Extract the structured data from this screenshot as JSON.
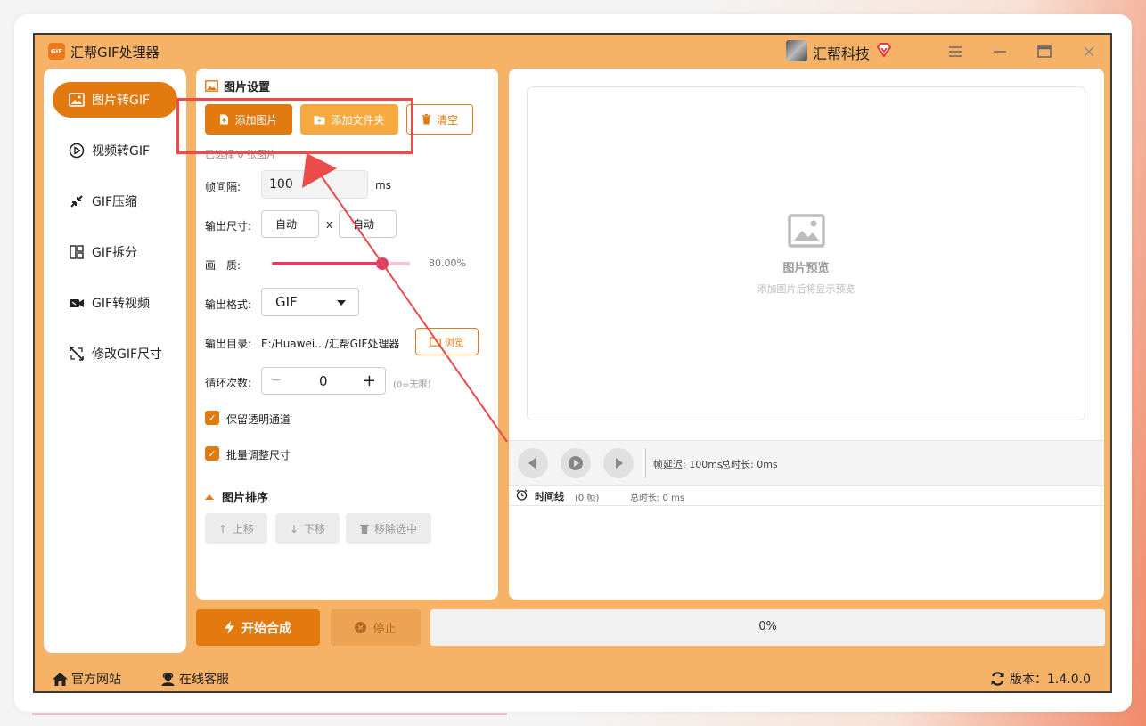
{
  "titlebar": {
    "logo_text": "GIF",
    "title": "汇帮GIF处理器",
    "brand": "汇帮科技"
  },
  "sidebar": {
    "items": [
      {
        "label": "图片转GIF",
        "icon": "image-icon",
        "active": true
      },
      {
        "label": "视频转GIF",
        "icon": "play-circle-icon"
      },
      {
        "label": "GIF压缩",
        "icon": "compress-icon"
      },
      {
        "label": "GIF拆分",
        "icon": "split-icon"
      },
      {
        "label": "GIF转视频",
        "icon": "video-camera-icon"
      },
      {
        "label": "修改GIF尺寸",
        "icon": "resize-icon"
      }
    ]
  },
  "settings": {
    "title": "图片设置",
    "add_image": "添加图片",
    "add_folder": "添加文件夹",
    "clear": "清空",
    "selected_count": "已选择 0 张图片",
    "frame_interval_label": "帧间隔:",
    "frame_interval_value": "100",
    "frame_interval_unit": "ms",
    "output_size_label": "输出尺寸:",
    "width_value": "自动",
    "size_sep": "x",
    "height_value": "自动",
    "quality_label": "画　质:",
    "quality_value": "80.00%",
    "quality_fraction": 0.8,
    "format_label": "输出格式:",
    "format_value": "GIF",
    "dir_label": "输出目录:",
    "dir_value": "E:/Huawei.../汇帮GIF处理器",
    "browse": "浏览",
    "loop_label": "循环次数:",
    "loop_minus": "−",
    "loop_value": "0",
    "loop_plus": "+",
    "loop_hint": "(0=无限)",
    "keep_alpha": "保留透明通道",
    "batch_resize": "批量调整尺寸",
    "sort_title": "图片排序",
    "move_up": "上移",
    "move_down": "下移",
    "remove_selected": "移除选中"
  },
  "preview": {
    "title": "图片预览",
    "hint": "添加图片后将显示预览",
    "frame_delay": "帧延迟: 100ms",
    "total_time": "总时长: 0ms",
    "timeline_label": "时间线",
    "timeline_frames": "(0 帧)",
    "timeline_total": "总时长: 0 ms"
  },
  "actions": {
    "start": "开始合成",
    "stop": "停止",
    "progress": "0%",
    "progress_fraction": 0
  },
  "footer": {
    "website": "官方网站",
    "support": "在线客服",
    "version": "版本：1.4.0.0"
  },
  "colors": {
    "accent": "#e37a10",
    "accent_light": "#f5a93e",
    "app_bg": "#f6b266",
    "annotation": "#ea4b4b"
  }
}
